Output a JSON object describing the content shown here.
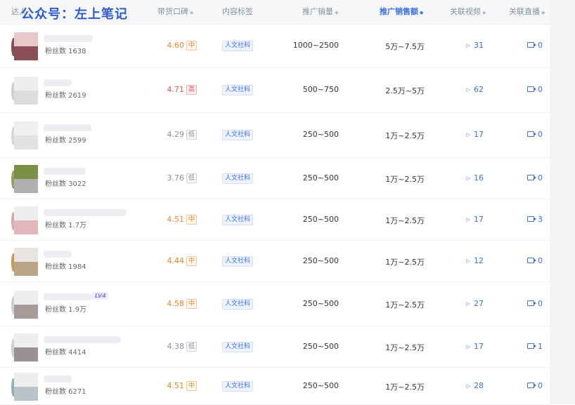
{
  "watermark": "公众号：左上笔记",
  "header": {
    "col_talent": "达人",
    "col_score": "带货口碑",
    "col_tag": "内容标签",
    "col_volume": "推广销量",
    "col_sales": "推广销售额",
    "col_video": "关联视频",
    "col_live": "关联直播"
  },
  "rows": [
    {
      "fans": "粉丝数 1638",
      "score": "4.60",
      "level": "中",
      "tag": "人文社科",
      "volume": "1000~2500",
      "sales": "5万~7.5万",
      "videos": "31",
      "lives": "0"
    },
    {
      "fans": "粉丝数 2619",
      "score": "4.71",
      "level": "高",
      "tag": "人文社科",
      "volume": "500~750",
      "sales": "2.5万~5万",
      "videos": "62",
      "lives": "0"
    },
    {
      "fans": "粉丝数 2599",
      "score": "4.29",
      "level": "低",
      "tag": "人文社科",
      "volume": "250~500",
      "sales": "1万~2.5万",
      "videos": "17",
      "lives": "0"
    },
    {
      "fans": "粉丝数 3022",
      "score": "3.76",
      "level": "低",
      "tag": "人文社科",
      "volume": "250~500",
      "sales": "1万~2.5万",
      "videos": "16",
      "lives": "0"
    },
    {
      "fans": "粉丝数 1.7万",
      "score": "4.51",
      "level": "中",
      "tag": "人文社科",
      "volume": "250~500",
      "sales": "1万~2.5万",
      "videos": "17",
      "lives": "3"
    },
    {
      "fans": "粉丝数 1984",
      "score": "4.44",
      "level": "中",
      "tag": "人文社科",
      "volume": "250~500",
      "sales": "1万~2.5万",
      "videos": "12",
      "lives": "0"
    },
    {
      "fans": "粉丝数 1.9万",
      "score": "4.58",
      "level": "中",
      "tag": "人文社科",
      "volume": "250~500",
      "sales": "1万~2.5万",
      "videos": "27",
      "lives": "0",
      "lv": "LV4"
    },
    {
      "fans": "粉丝数 4414",
      "score": "4.38",
      "level": "低",
      "tag": "人文社科",
      "volume": "250~500",
      "sales": "1万~2.5万",
      "videos": "17",
      "lives": "1"
    },
    {
      "fans": "粉丝数 6271",
      "score": "4.51",
      "level": "中",
      "tag": "人文社科",
      "volume": "250~500",
      "sales": "1万~2.5万",
      "videos": "28",
      "lives": "0"
    }
  ],
  "colors": {
    "accent": "#3a6fe8",
    "score_mid": "#e8862a",
    "score_high": "#e05353",
    "score_low": "#8a8f99"
  }
}
